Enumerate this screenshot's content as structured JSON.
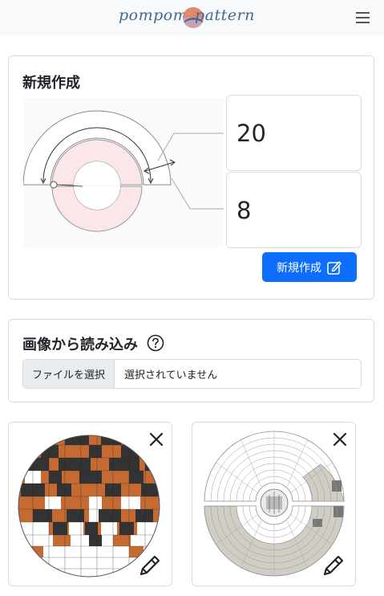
{
  "navbar": {
    "logo_left": "pompom",
    "logo_right": "pattern",
    "menu_icon": "hamburger-menu-icon"
  },
  "new_card": {
    "title": "新規作成",
    "value_outer": "20",
    "value_inner": "8",
    "create_label": "新規作成",
    "create_icon": "edit-icon"
  },
  "import_card": {
    "title": "画像から読み込み",
    "help_icon": "question-circle-icon",
    "file_button_label": "ファイルを選択",
    "file_status": "選択されていません"
  },
  "thumbnails": [
    {
      "kind": "pompom-ball-preview",
      "close_icon": "close-icon",
      "edit_icon": "pencil-icon"
    },
    {
      "kind": "pattern-chart-preview",
      "close_icon": "close-icon",
      "edit_icon": "pencil-icon"
    }
  ],
  "colors": {
    "brand": "#3f6a93",
    "primary": "#0d6efd",
    "ring_fill": "#fbe6e9",
    "ball_orange": "#c46a32",
    "ball_dark": "#333333",
    "chart_gray": "#cfcdc4"
  }
}
